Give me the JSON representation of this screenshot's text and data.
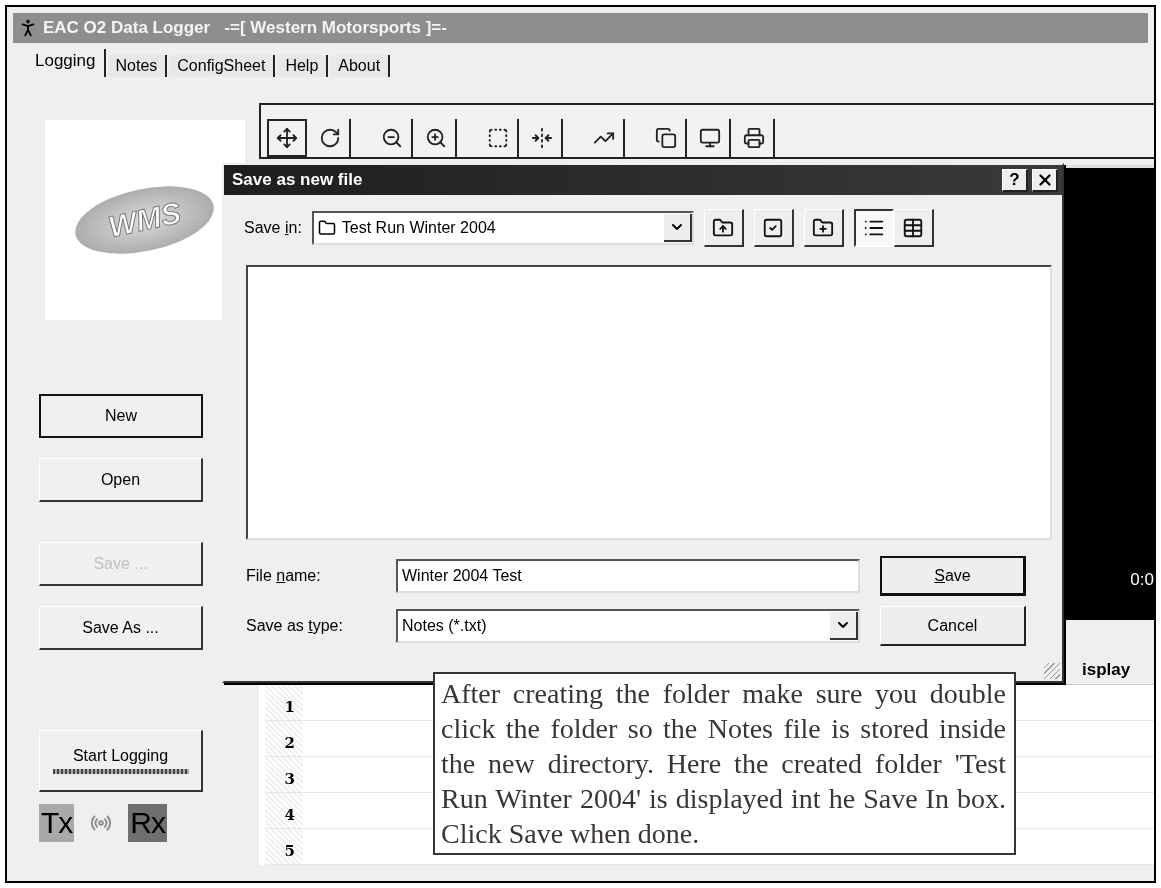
{
  "window": {
    "title": "EAC O2 Data Logger   -=[ Western Motorsports ]=-"
  },
  "tabs": [
    {
      "label": "Logging",
      "selected": true
    },
    {
      "label": "Notes",
      "selected": false
    },
    {
      "label": "ConfigSheet",
      "selected": false
    },
    {
      "label": "Help",
      "selected": false
    },
    {
      "label": "About",
      "selected": false
    }
  ],
  "sidebar": {
    "logo_text": "WMS",
    "buttons": [
      {
        "label": "New",
        "default": true,
        "disabled": false
      },
      {
        "label": "Open",
        "default": false,
        "disabled": false
      },
      {
        "label": "Save ...",
        "default": false,
        "disabled": true
      },
      {
        "label": "Save As ...",
        "default": false,
        "disabled": false
      }
    ],
    "start_logging": "Start Logging",
    "tx": "Tx",
    "rx": "Rx"
  },
  "display": {
    "time": "0:0"
  },
  "grid": {
    "column_heading": "isplay",
    "rows": [
      "1",
      "2",
      "3",
      "4",
      "5"
    ]
  },
  "dialog": {
    "title": "Save as new file",
    "help": "?",
    "save_in": {
      "pre": "Save ",
      "key": "i",
      "post": "n:"
    },
    "folder": "Test Run Winter 2004",
    "view_buttons": [
      {
        "kind": "list",
        "selected": true
      },
      {
        "kind": "details",
        "selected": false
      }
    ],
    "file_name_label": {
      "pre": "File ",
      "key": "n",
      "post": "ame:"
    },
    "file_name": "Winter 2004 Test",
    "type_label": {
      "pre": "Save as ",
      "key": "t",
      "post": "ype:"
    },
    "type": "Notes (*.txt)",
    "save_button": {
      "key": "S",
      "post": "ave"
    },
    "cancel_button": "Cancel"
  },
  "note": "After creating the folder make sure you double click the folder so the Notes file is stored inside the new directory.  Here the created folder  'Test Run Winter 2004' is displayed int he Save In box.  Click Save when done."
}
